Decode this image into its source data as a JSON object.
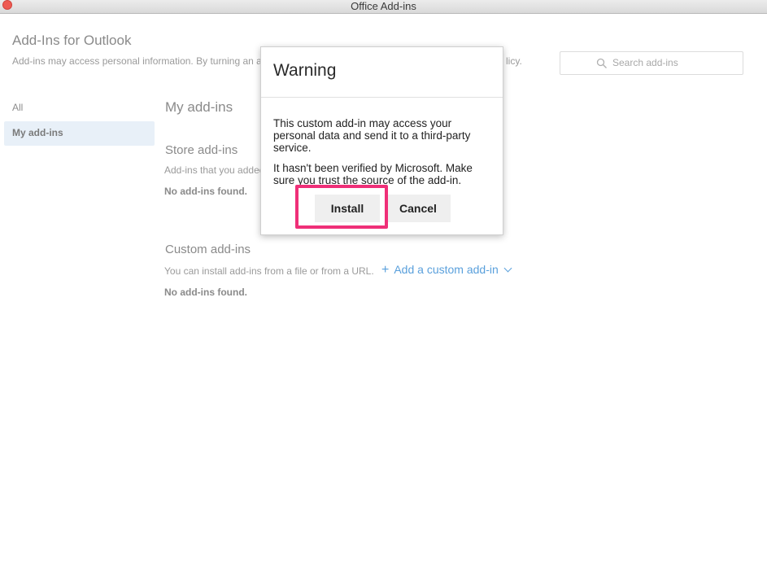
{
  "window": {
    "title": "Office Add-ins"
  },
  "header": {
    "title": "Add-Ins for Outlook",
    "subtitle_start": "Add-ins may access personal information. By turning an a",
    "subtitle_end": "licy.",
    "search_placeholder": "Search add-ins"
  },
  "sidebar": {
    "items": [
      {
        "label": "All"
      },
      {
        "label": "My add-ins"
      }
    ]
  },
  "main": {
    "heading": "My add-ins",
    "store": {
      "heading": "Store add-ins",
      "description": "Add-ins that you added",
      "empty": "No add-ins found."
    },
    "custom": {
      "heading": "Custom add-ins",
      "description": "You can install add-ins from a file or from a URL.",
      "link": "Add a custom add-in",
      "empty": "No add-ins found."
    }
  },
  "dialog": {
    "title": "Warning",
    "paragraph1": "This custom add-in may access your personal data and send it to a third-party service.",
    "paragraph2": "It hasn't been verified by Microsoft. Make sure you trust the source of the add-in.",
    "install_label": "Install",
    "cancel_label": "Cancel"
  },
  "colors": {
    "accent": "#5aa0dc",
    "highlight": "#ef2f78",
    "close": "#ee5a52"
  }
}
